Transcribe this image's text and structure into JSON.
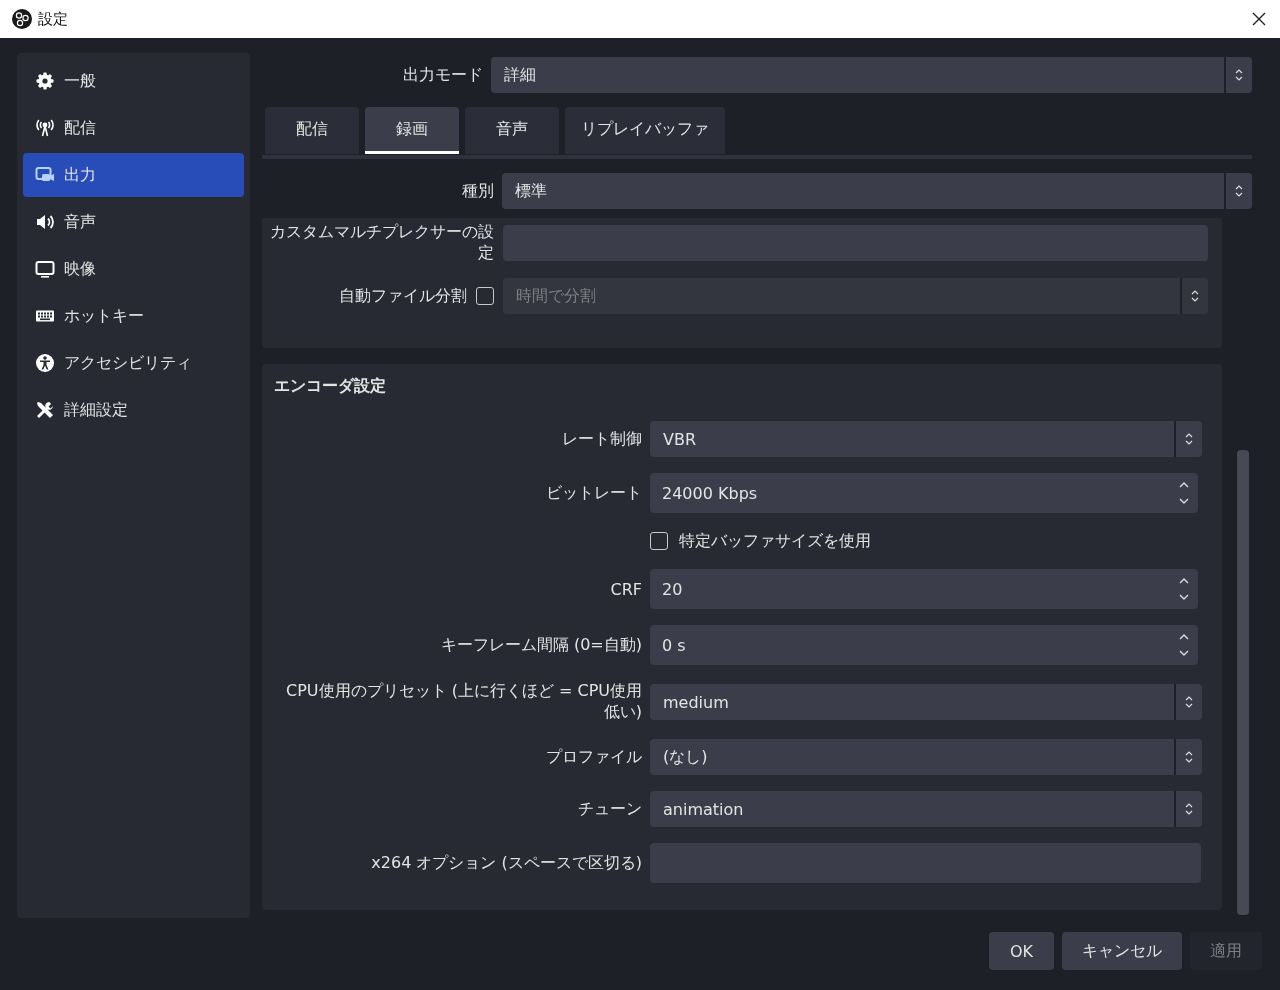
{
  "window": {
    "title": "設定"
  },
  "sidebar": {
    "items": [
      {
        "label": "一般",
        "selected": false
      },
      {
        "label": "配信",
        "selected": false
      },
      {
        "label": "出力",
        "selected": true
      },
      {
        "label": "音声",
        "selected": false
      },
      {
        "label": "映像",
        "selected": false
      },
      {
        "label": "ホットキー",
        "selected": false
      },
      {
        "label": "アクセシビリティ",
        "selected": false
      },
      {
        "label": "詳細設定",
        "selected": false
      }
    ]
  },
  "output_mode": {
    "label": "出力モード",
    "value": "詳細"
  },
  "tabs": [
    {
      "label": "配信",
      "selected": false
    },
    {
      "label": "録画",
      "selected": true
    },
    {
      "label": "音声",
      "selected": false
    },
    {
      "label": "リプレイバッファ",
      "selected": false
    }
  ],
  "type": {
    "label": "種別",
    "value": "標準"
  },
  "custom_muxer": {
    "label": "カスタムマルチプレクサーの設定"
  },
  "auto_split": {
    "label": "自動ファイル分割",
    "checked": false,
    "value": "時間で分割",
    "disabled": true
  },
  "encoder": {
    "title": "エンコーダ設定",
    "rows": [
      {
        "kind": "select",
        "label": "レート制御",
        "value": "VBR"
      },
      {
        "kind": "spin",
        "label": "ビットレート",
        "value": "24000 Kbps"
      },
      {
        "kind": "checkbox",
        "label": "特定バッファサイズを使用",
        "checked": false
      },
      {
        "kind": "spin",
        "label": "CRF",
        "value": "20"
      },
      {
        "kind": "spin",
        "label": "キーフレーム間隔 (0=自動)",
        "value": "0 s"
      },
      {
        "kind": "select",
        "label": "CPU使用のプリセット (上に行くほど = CPU使用低い)",
        "value": "medium"
      },
      {
        "kind": "select",
        "label": "プロファイル",
        "value": "(なし)"
      },
      {
        "kind": "select",
        "label": "チューン",
        "value": "animation"
      },
      {
        "kind": "text",
        "label": "x264 オプション (スペースで区切る)"
      }
    ]
  },
  "buttons": [
    {
      "label": "OK",
      "disabled": false
    },
    {
      "label": "キャンセル",
      "disabled": false
    },
    {
      "label": "適用",
      "disabled": true
    }
  ]
}
